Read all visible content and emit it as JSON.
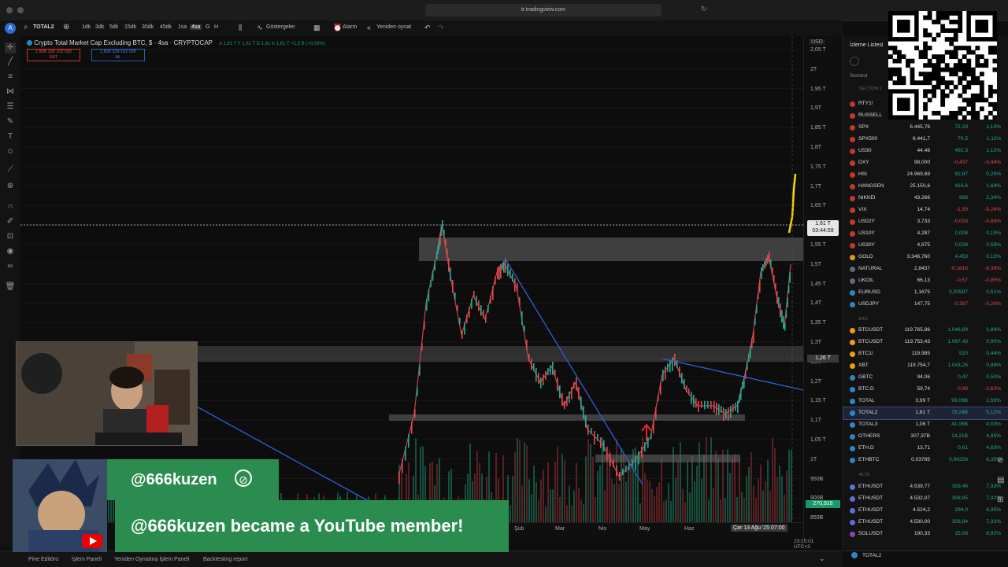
{
  "browser": {
    "url": "tr.tradingview.com"
  },
  "toolbar": {
    "symbol": "TOTAL2",
    "timeframes": [
      "1dk",
      "3dk",
      "5dk",
      "15dk",
      "30dk",
      "45dk",
      "1sa",
      "4sa",
      "G",
      "H"
    ],
    "indicators_label": "Göstergeler",
    "alarm_label": "Alarm",
    "replay_label": "Yeniden oynat"
  },
  "legend": {
    "title": "Crypto Total Market Cap Excluding BTC, $ · 4sa · CRYPTOCAP",
    "ohlc": "A 1,61 T  Y 1,61 T  D 1,61  K 1,61 T +1,5 B (+0,09%)",
    "sell_value": "1,60K 339 102 030",
    "sell_label": "SAT",
    "buy_value": "1,606 329 102 030",
    "buy_label": "AL"
  },
  "price_axis": {
    "currency": "USD",
    "labels": [
      "2,05 T",
      "2T",
      "1,95 T",
      "1,9T",
      "1,85 T",
      "1,8T",
      "1,75 T",
      "1,7T",
      "1,65 T",
      "1,6T",
      "1,55 T",
      "1,5T",
      "1,45 T",
      "1,4T",
      "1,35 T",
      "1,3T",
      "1,25 T",
      "1,2T",
      "1,15 T",
      "1,1T",
      "1,05 T",
      "1T",
      "950B",
      "900B",
      "850B"
    ],
    "current_price": "1,61 T",
    "countdown": "03:44:59",
    "cross_price": "1,26 T",
    "volume_label": "270,918"
  },
  "time_axis": {
    "labels": [
      "Şub",
      "Mar",
      "Nis",
      "May",
      "Haz"
    ],
    "cursor_date": "Çar 13 Ağu '25  07:00",
    "clock": "23:15:01 UTC+3"
  },
  "bottom_bar": {
    "tabs": [
      "Pine Editörü",
      "İşlem Paneli",
      "Yeniden Oynatma İşlem Paneli",
      "Backtesting report"
    ]
  },
  "watchlist": {
    "title": "İzleme Listesi",
    "column_symbol": "Sembol",
    "section1": "SECTION 2",
    "section2": "BTC",
    "section3": "ALTS",
    "rows1": [
      {
        "sym": "RTY1!",
        "last": "",
        "chg": "",
        "pct": "",
        "color": "#c0392b"
      },
      {
        "sym": "RUSSELL",
        "last": "",
        "chg": "",
        "pct": "",
        "color": "#c0392b"
      },
      {
        "sym": "SPX",
        "last": "6.445,76",
        "chg": "72,29",
        "pct": "1,13%",
        "color": "#c0392b"
      },
      {
        "sym": "SPX500",
        "last": "6.441,7",
        "chg": "70,5",
        "pct": "1,11%",
        "color": "#c0392b"
      },
      {
        "sym": "US30",
        "last": "44.46",
        "chg": "492,3",
        "pct": "1,12%",
        "color": "#c0392b"
      },
      {
        "sym": "DXY",
        "last": "98,000",
        "chg": "-0,437",
        "pct": "-0,44%",
        "color": "#c0392b"
      },
      {
        "sym": "HSI",
        "last": "24.969,69",
        "chg": "82,87",
        "pct": "0,25%",
        "color": "#c0392b"
      },
      {
        "sym": "HANGSEN",
        "last": "25.150,6",
        "chg": "416,6",
        "pct": "1,68%",
        "color": "#c0392b"
      },
      {
        "sym": "NIKKEI",
        "last": "43.266",
        "chg": "968",
        "pct": "2,34%",
        "color": "#c0392b"
      },
      {
        "sym": "VIX",
        "last": "14,74",
        "chg": "-1,50",
        "pct": "-9,24%",
        "color": "#c0392b"
      },
      {
        "sym": "US02Y",
        "last": "3,733",
        "chg": "-0,033",
        "pct": "-0,88%",
        "color": "#c0392b"
      },
      {
        "sym": "US10Y",
        "last": "4,287",
        "chg": "0,008",
        "pct": "0,19%",
        "color": "#c0392b"
      },
      {
        "sym": "US30Y",
        "last": "4,875",
        "chg": "0,028",
        "pct": "0,58%",
        "color": "#c0392b"
      },
      {
        "sym": "GOLD",
        "last": "3.346,760",
        "chg": "4,453",
        "pct": "0,13%",
        "color": "#d4a017"
      },
      {
        "sym": "NATURAL",
        "last": "2,8437",
        "chg": "-0,1816",
        "pct": "-6,38%",
        "color": "#5d6d7e"
      },
      {
        "sym": "UKOIL",
        "last": "66,13",
        "chg": "-0,57",
        "pct": "-0,85%",
        "color": "#5d6d7e"
      },
      {
        "sym": "EURUSD",
        "last": "1,1675",
        "chg": "0,00597",
        "pct": "0,51%",
        "color": "#2e86c1"
      },
      {
        "sym": "USDJPY",
        "last": "147,75",
        "chg": "-0,387",
        "pct": "-0,26%",
        "color": "#2e86c1"
      }
    ],
    "rows2": [
      {
        "sym": "BTCUSDT",
        "last": "119.765,86",
        "chg": "1.046,89",
        "pct": "0,88%",
        "color": "#f39c12"
      },
      {
        "sym": "BTCUSDT",
        "last": "119.753,43",
        "chg": "1.067,43",
        "pct": "0,90%",
        "color": "#f39c12"
      },
      {
        "sym": "BTC1!",
        "last": "119.985",
        "chg": "520",
        "pct": "0,44%",
        "color": "#f39c12"
      },
      {
        "sym": "XBT",
        "last": "119.754,7",
        "chg": "1.043,25",
        "pct": "0,88%",
        "color": "#f39c12"
      },
      {
        "sym": "GBTC",
        "last": "94,06",
        "chg": "0,47",
        "pct": "0,50%",
        "color": "#2e86c1"
      },
      {
        "sym": "BTC.D",
        "last": "59,74",
        "chg": "-0,99",
        "pct": "-1,62%",
        "color": "#2e86c1"
      },
      {
        "sym": "TOTAL",
        "last": "3,99 T",
        "chg": "99,03B",
        "pct": "2,55%",
        "color": "#2e86c1"
      },
      {
        "sym": "TOTAL2",
        "last": "1,61 T",
        "chg": "78,24B",
        "pct": "5,12%",
        "color": "#2e86c1"
      },
      {
        "sym": "TOTAL3",
        "last": "1,06 T",
        "chg": "41,05B",
        "pct": "4,03%",
        "color": "#2e86c1"
      },
      {
        "sym": "OTHERS",
        "last": "307,37B",
        "chg": "14,21B",
        "pct": "4,85%",
        "color": "#2e86c1"
      },
      {
        "sym": "ETH.D",
        "last": "13,71",
        "chg": "0,61",
        "pct": "4,63%",
        "color": "#2e86c1"
      },
      {
        "sym": "ETHBTC",
        "last": "0,03785",
        "chg": "0,00226",
        "pct": "6,35%",
        "color": "#2e86c1"
      }
    ],
    "rows3": [
      {
        "sym": "ETHUSDT",
        "last": "4.539,77",
        "chg": "309,46",
        "pct": "7,33%",
        "color": "#5d6dde"
      },
      {
        "sym": "ETHUSDT",
        "last": "4.532,07",
        "chg": "308,85",
        "pct": "7,31%",
        "color": "#5d6dde"
      },
      {
        "sym": "ETHUSDT",
        "last": "4.524,2",
        "chg": "294,0",
        "pct": "6,95%",
        "color": "#5d6dde"
      },
      {
        "sym": "ETHUSDT",
        "last": "4.530,00",
        "chg": "308,84",
        "pct": "7,31%",
        "color": "#5d6dde"
      },
      {
        "sym": "SOLUSDT",
        "last": "190,33",
        "chg": "15,58",
        "pct": "8,92%",
        "color": "#8e44ad"
      }
    ],
    "footer_symbol": "TOTAL2"
  },
  "overlay": {
    "handle": "@666kuzen",
    "message": "@666kuzen became a YouTube member!"
  }
}
